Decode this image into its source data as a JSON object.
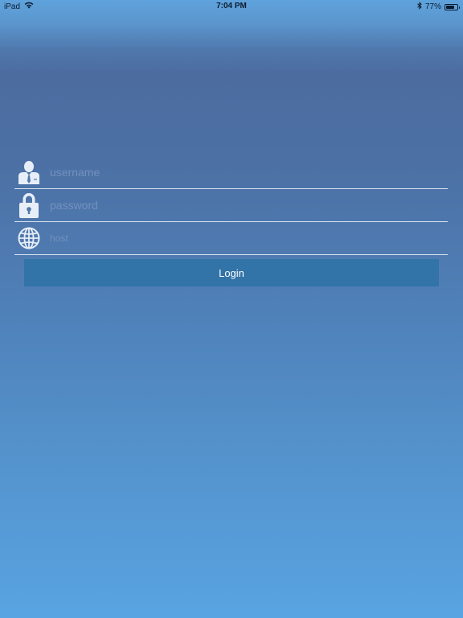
{
  "status_bar": {
    "device": "iPad",
    "time": "7:04 PM",
    "battery_text": "77%",
    "battery_level": 0.77,
    "icons": [
      "wifi-icon",
      "bluetooth-icon",
      "battery-icon"
    ]
  },
  "login_form": {
    "username": {
      "placeholder": "username",
      "value": "",
      "icon": "user-icon"
    },
    "password": {
      "placeholder": "password",
      "value": "",
      "icon": "lock-icon"
    },
    "host": {
      "placeholder": "host",
      "value": "",
      "icon": "globe-icon"
    },
    "login_label": "Login"
  },
  "colors": {
    "gradient_top": "#4c6c9f",
    "gradient_bottom": "#58a4e2",
    "button_bg": "#3273a8",
    "button_text": "#ffffff",
    "divider": "#ebf2fa",
    "placeholder": "#7391bd",
    "icon_fill": "#e8eef8"
  }
}
